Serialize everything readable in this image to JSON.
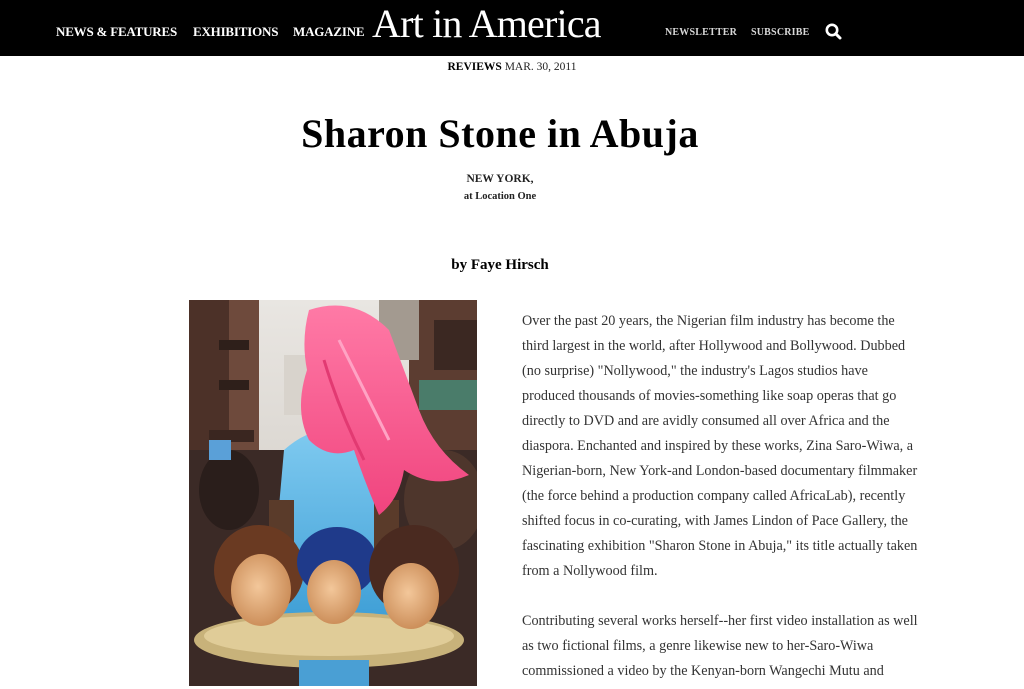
{
  "nav": {
    "news_features": "NEWS & FEATURES",
    "exhibitions": "EXHIBITIONS",
    "magazine": "MAGAZINE",
    "logo": "Art in America",
    "newsletter": "NEWSLETTER",
    "subscribe": "SUBSCRIBE",
    "search_icon": "search-icon"
  },
  "article": {
    "category": "REVIEWS",
    "date": "MAR. 30, 2011",
    "title": "Sharon Stone in Abuja",
    "location_city": "NEW YORK,",
    "location_venue": "at Location One",
    "byline": "by Faye Hirsch",
    "paragraph1": [
      "Over the past 20 years, the Nigerian film industry has become the",
      "third largest in the world, after Hollywood and Bollywood. Dubbed",
      "(no surprise) \"Nollywood,\" the industry's Lagos studios have",
      "produced thousands of movies-something like soap operas that go",
      "directly to DVD and are avidly consumed all over Africa and the",
      "diaspora. Enchanted and inspired by these works, Zina Saro-Wiwa, a",
      "Nigerian-born, New York-and London-based documentary filmmaker",
      "(the force behind a production company called AfricaLab), recently",
      "shifted focus in co-curating, with James Lindon of Pace Gallery, the",
      "fascinating exhibition \"Sharon Stone in Abuja,\" its title actually taken",
      "from a Nollywood film."
    ],
    "paragraph2": [
      "Contributing several works herself--her first video installation as well",
      "as two fictional films, a genre likewise new to her-Saro-Wiwa",
      "commissioned a video by the Kenyan-born Wangechi Mutu and"
    ]
  },
  "colors": {
    "topbar": "#000000",
    "body_text": "#333333",
    "wig_pink": "#ff5a8c",
    "dress_blue": "#5fb8e8"
  }
}
